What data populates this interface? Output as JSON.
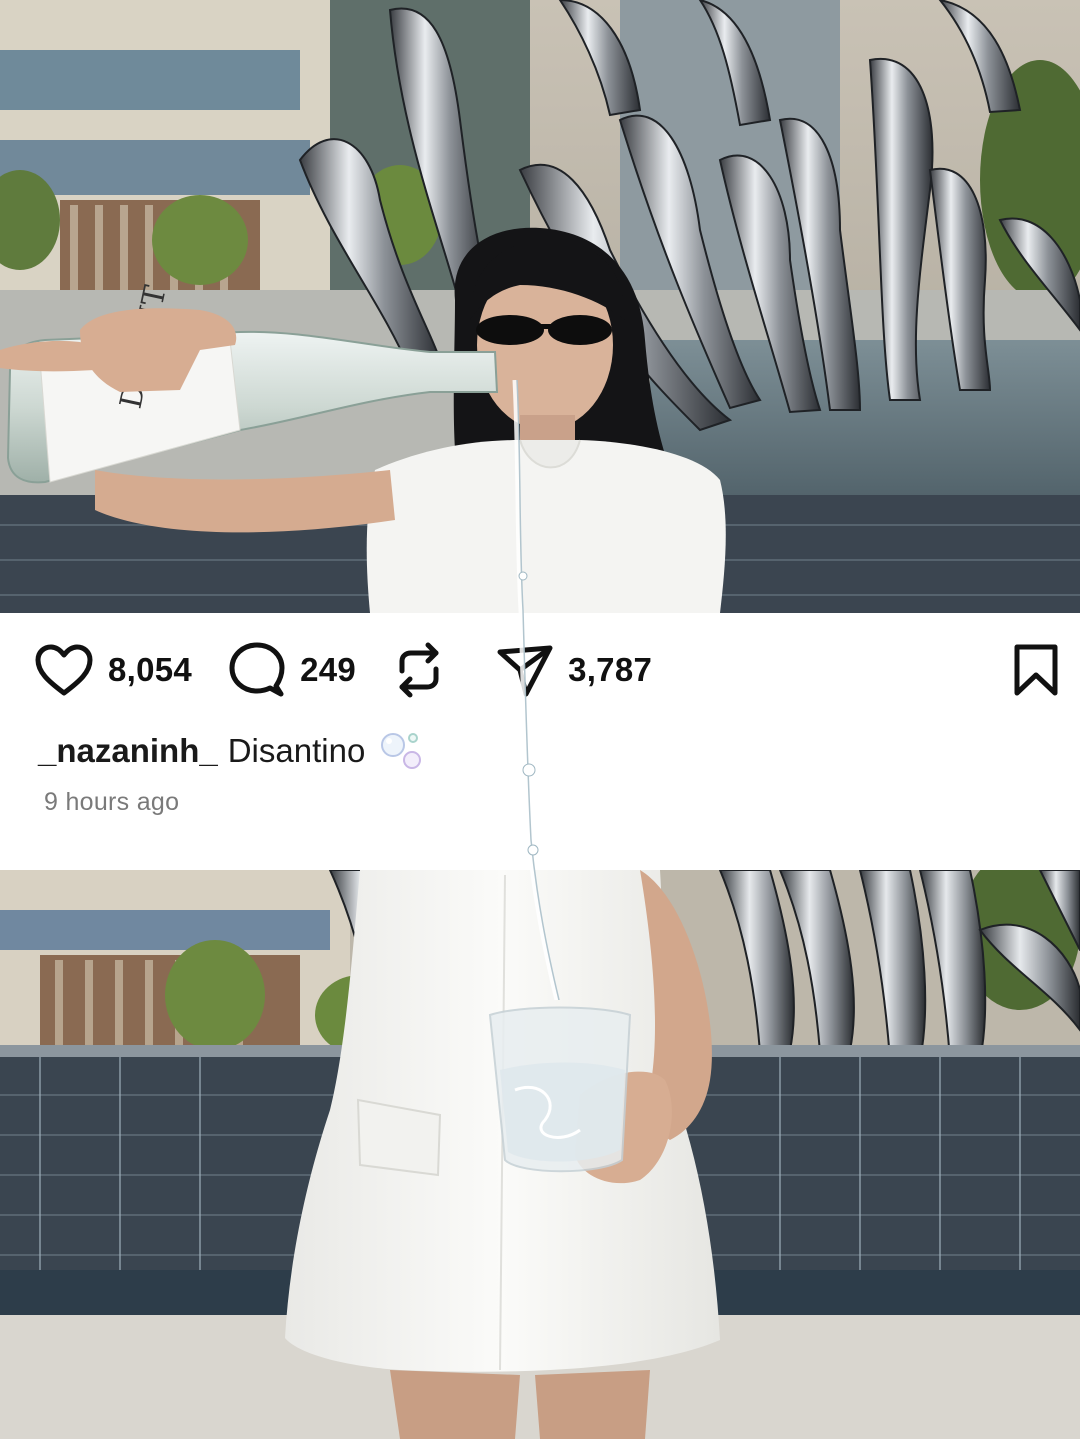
{
  "post": {
    "likes": "8,054",
    "comments": "249",
    "shares": "3,787",
    "username": "_nazaninh_",
    "caption": "Disantino",
    "time_ago": "9 hours ago"
  },
  "bottle_label": "DISANT",
  "icons": {
    "like": "heart-outline-icon",
    "comment": "speech-bubble-icon",
    "repost": "repost-arrows-icon",
    "share": "paper-plane-icon",
    "save": "bookmark-icon",
    "emoji": "bubbles-emoji"
  },
  "colors": {
    "text": "#111111",
    "muted": "#7a7a7a",
    "background": "#ffffff"
  }
}
